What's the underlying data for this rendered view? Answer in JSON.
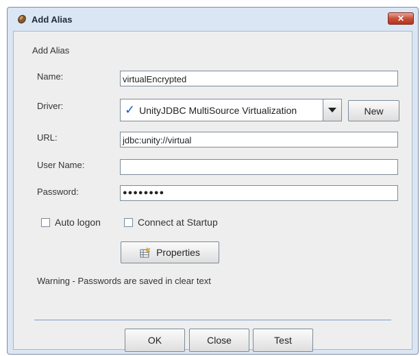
{
  "window": {
    "title": "Add Alias",
    "close_glyph": "✕"
  },
  "panel": {
    "header": "Add Alias"
  },
  "form": {
    "name_label": "Name:",
    "name_value": "virtualEncrypted",
    "driver_label": "Driver:",
    "driver_value": "UnityJDBC MultiSource Virtualization",
    "driver_check": "✓",
    "new_label": "New",
    "url_label": "URL:",
    "url_value": "jdbc:unity://virtual",
    "user_label": "User Name:",
    "user_value": "",
    "password_label": "Password:",
    "password_value": "●●●●●●●●"
  },
  "options": {
    "auto_logon": "Auto logon",
    "connect_startup": "Connect at Startup"
  },
  "properties_label": "Properties",
  "warning": "Warning - Passwords are saved in clear text",
  "buttons": {
    "ok": "OK",
    "close": "Close",
    "test": "Test"
  },
  "icons": {
    "title": "alias-icon",
    "properties": "properties-icon",
    "close": "close-icon"
  }
}
